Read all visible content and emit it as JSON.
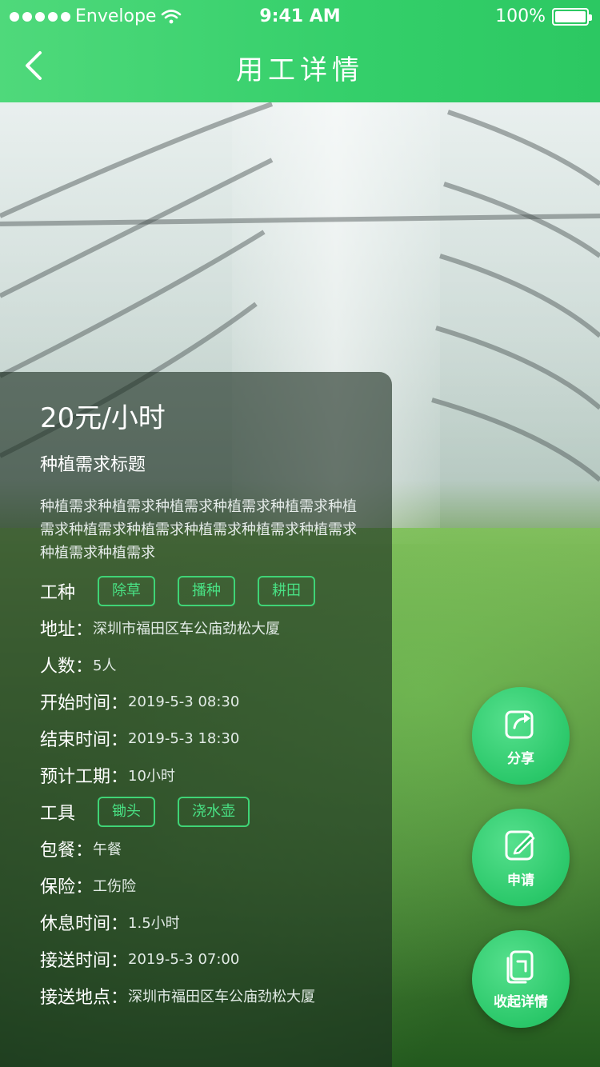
{
  "status_bar": {
    "carrier": "Envelope",
    "time": "9:41 AM",
    "battery": "100%"
  },
  "nav": {
    "title": "用工详情",
    "back_icon": "chevron-left-icon"
  },
  "card": {
    "price": "20元/小时",
    "title": "种植需求标题",
    "description": "种植需求种植需求种植需求种植需求种植需求种植需求种植需求种植需求种植需求种植需求种植需求种植需求种植需求",
    "work_type": {
      "label": "工种",
      "tags": [
        "除草",
        "播种",
        "耕田"
      ]
    },
    "address": {
      "label": "地址：",
      "value": "深圳市福田区车公庙劲松大厦"
    },
    "headcount": {
      "label": "人数：",
      "value": "5人"
    },
    "start_time": {
      "label": "开始时间：",
      "value": "2019-5-3 08:30"
    },
    "end_time": {
      "label": "结束时间：",
      "value": "2019-5-3 18:30"
    },
    "duration": {
      "label": "预计工期：",
      "value": "10小时"
    },
    "tools": {
      "label": "工具",
      "tags": [
        "锄头",
        "浇水壶"
      ]
    },
    "meals": {
      "label": "包餐：",
      "value": "午餐"
    },
    "insurance": {
      "label": "保险：",
      "value": "工伤险"
    },
    "rest_time": {
      "label": "休息时间：",
      "value": "1.5小时"
    },
    "pickup_time": {
      "label": "接送时间：",
      "value": "2019-5-3 07:00"
    },
    "pickup_place": {
      "label": "接送地点：",
      "value": "深圳市福田区车公庙劲松大厦"
    }
  },
  "actions": {
    "share": {
      "label": "分享",
      "icon": "share-icon"
    },
    "apply": {
      "label": "申请",
      "icon": "edit-icon"
    },
    "collapse": {
      "label": "收起详情",
      "icon": "collapse-icon"
    }
  },
  "colors": {
    "accent": "#2cc862",
    "tag_border": "#3fd476",
    "card_bg": "rgba(28,45,32,0.62)"
  }
}
